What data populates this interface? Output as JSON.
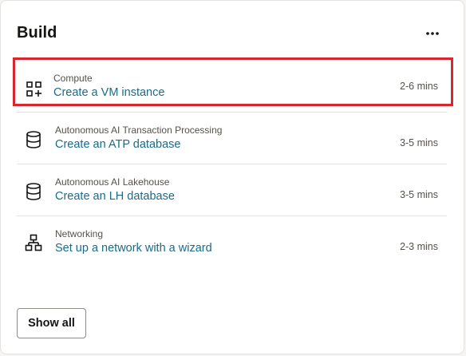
{
  "card": {
    "title": "Build",
    "more_icon": "more-horizontal-icon"
  },
  "items": [
    {
      "category": "Compute",
      "link": "Create a VM instance",
      "time": "2-6 mins",
      "icon": "grid-plus-icon",
      "highlighted": true
    },
    {
      "category": "Autonomous AI Transaction Processing",
      "link": "Create an ATP database",
      "time": "3-5 mins",
      "icon": "database-icon"
    },
    {
      "category": "Autonomous AI Lakehouse",
      "link": "Create an LH database",
      "time": "3-5 mins",
      "icon": "database-icon"
    },
    {
      "category": "Networking",
      "link": "Set up a network with a wizard",
      "time": "2-3 mins",
      "icon": "network-icon"
    }
  ],
  "footer": {
    "show_all_label": "Show all"
  },
  "colors": {
    "link": "#1a6b8a",
    "highlight": "#d7262e",
    "text_primary": "#161513",
    "text_secondary": "#55514b"
  }
}
